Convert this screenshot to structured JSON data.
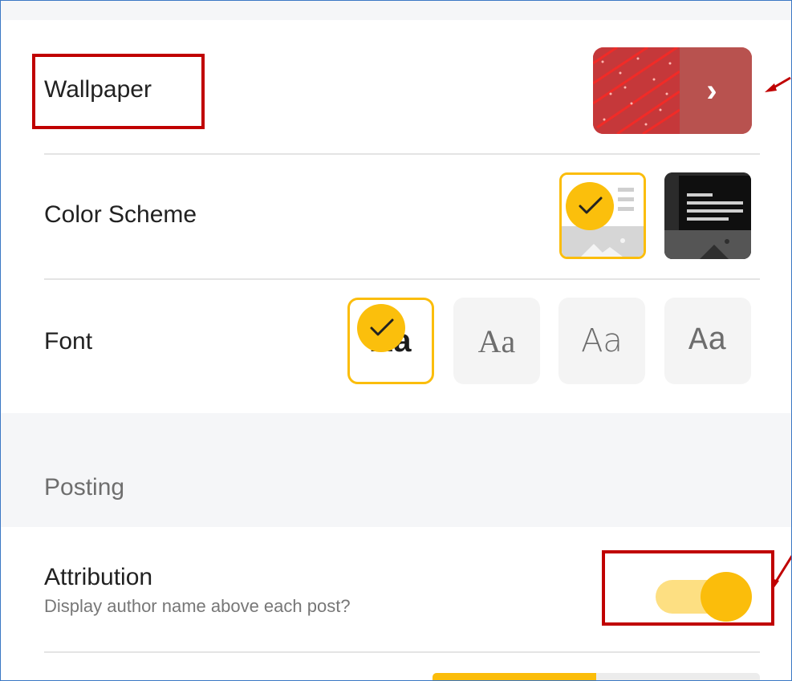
{
  "settings": {
    "wallpaper": {
      "label": "Wallpaper"
    },
    "color_scheme": {
      "label": "Color Scheme",
      "selected": "light"
    },
    "font": {
      "label": "Font",
      "options": [
        {
          "sample": "Aa",
          "selected": true
        },
        {
          "sample": "Aa",
          "selected": false
        },
        {
          "sample": "Aa",
          "selected": false
        },
        {
          "sample": "Aa",
          "selected": false
        }
      ]
    },
    "posting": {
      "section_title": "Posting",
      "attribution": {
        "title": "Attribution",
        "description": "Display author name above each post?",
        "enabled": true
      }
    }
  },
  "icons": {
    "wallpaper_chevron": "chevron-right-icon",
    "selected_check": "check-icon"
  },
  "colors": {
    "accent": "#fbbd0b",
    "wallpaper": "#c4383a",
    "annotation": "#c00000"
  }
}
